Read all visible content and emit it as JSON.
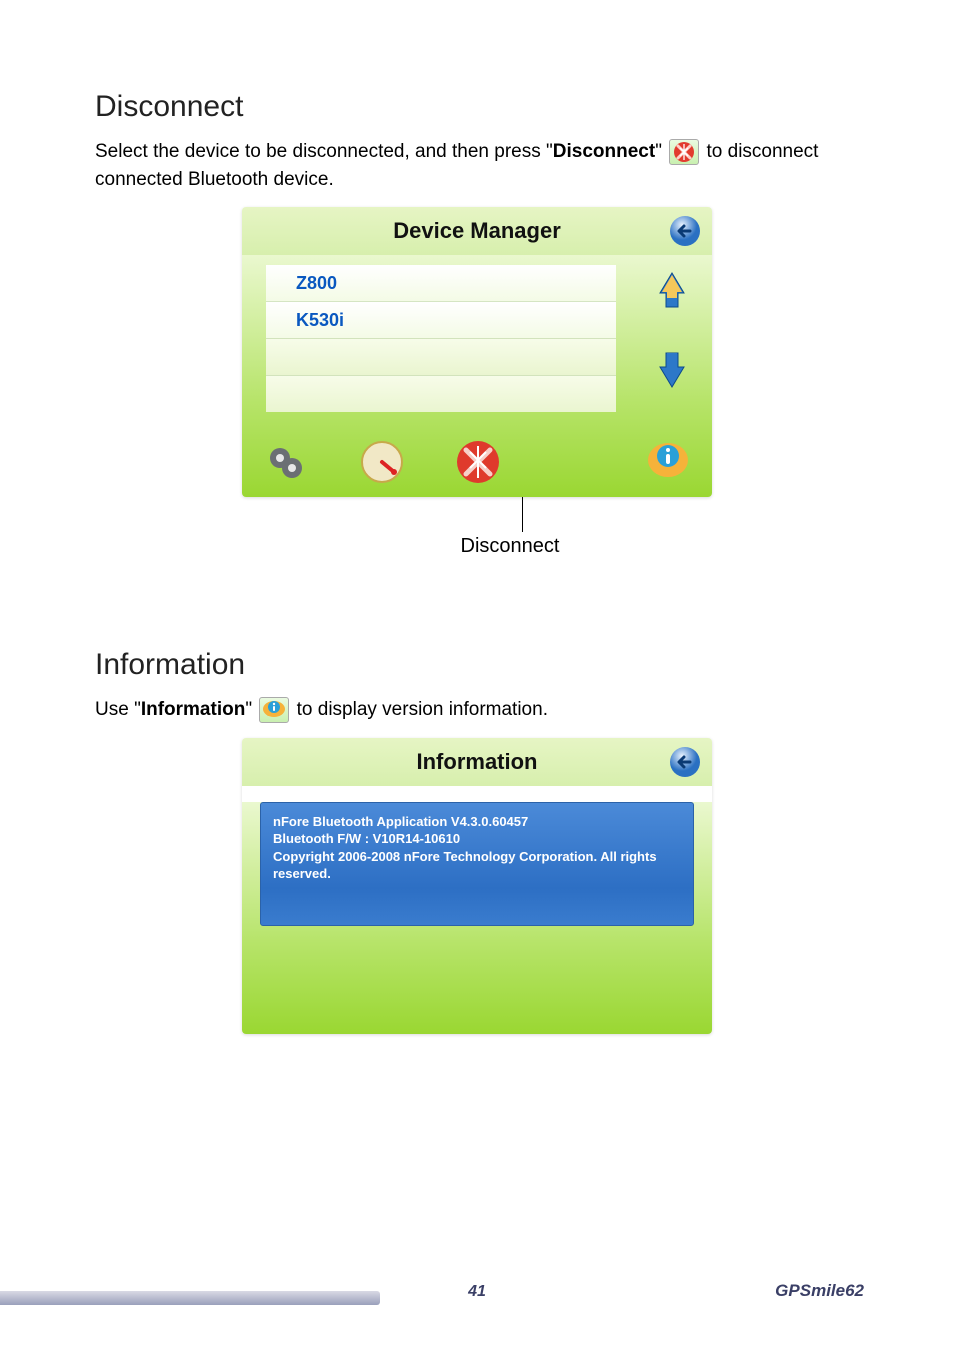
{
  "section1": {
    "heading": "Disconnect",
    "para_pre": "Select the device to be disconnected, and then press \"",
    "para_bold": "Disconnect",
    "para_post1": "\" ",
    "para_post2": " to disconnect connected Bluetooth device.",
    "callout": "Disconnect"
  },
  "devmgr": {
    "title": "Device Manager",
    "devices": [
      "Z800",
      "K530i",
      "",
      ""
    ]
  },
  "section2": {
    "heading": "Information",
    "para_pre": "Use \"",
    "para_bold": "Information",
    "para_post1": "\" ",
    "para_post2": " to display version information."
  },
  "infopanel": {
    "title": "Information",
    "line1": "nFore Bluetooth Application V4.3.0.60457",
    "line2": "Bluetooth F/W : V10R14-10610",
    "line3": "Copyright 2006-2008 nFore Technology Corporation. All rights reserved."
  },
  "footer": {
    "page": "41",
    "brand": "GPSmile62"
  }
}
